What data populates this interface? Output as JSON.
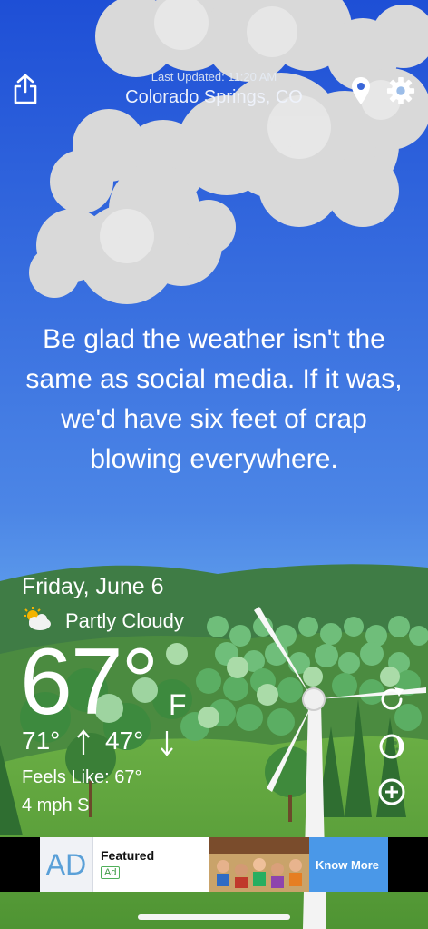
{
  "header": {
    "last_updated": "Last Updated: 11:20 AM",
    "location": "Colorado Springs, CO"
  },
  "icons": {
    "share": "share-icon",
    "location": "location-pin-icon",
    "settings": "gear-icon",
    "refresh": "refresh-icon",
    "theme": "theme-icon",
    "add": "add-icon",
    "weather": "partly-cloudy-icon"
  },
  "quote": "Be glad the weather isn't the same as social media. If it was, we'd have six feet of crap blowing everywhere.",
  "weather": {
    "date": "Friday, June 6",
    "condition": "Partly Cloudy",
    "temperature": "67°",
    "unit": "F",
    "high": "71°",
    "low": "47°",
    "feels_like": "Feels Like: 67°",
    "wind": "4 mph S"
  },
  "ad": {
    "logo": "AD",
    "title": "Featured",
    "badge": "Ad",
    "cta": "Know More"
  },
  "colors": {
    "sky_top": "#1e4fd6",
    "sky_bottom": "#73b6f0",
    "hill_dark": "#3d7a3f",
    "grass": "#5da23a",
    "ad_cta": "#4a98e8"
  }
}
